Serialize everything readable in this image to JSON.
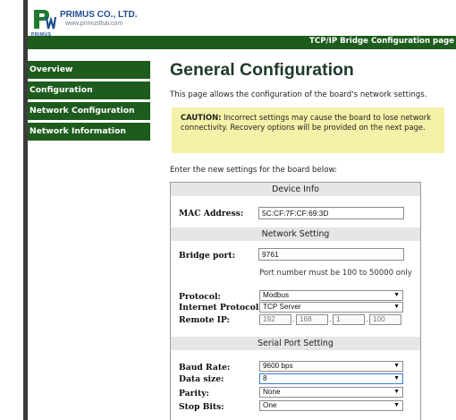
{
  "brand": {
    "company": "PRIMUS CO., LTD.",
    "website": "www.primusthai.com",
    "logo_word": "PRIMUS"
  },
  "header": {
    "title": "TCP/IP Bridge Configuration page"
  },
  "nav": {
    "items": [
      {
        "label": "Overview"
      },
      {
        "label": "Configuration"
      },
      {
        "label": "Network Configuration"
      },
      {
        "label": "Network Information"
      }
    ]
  },
  "main": {
    "title": "General Configuration",
    "intro": "This page allows the configuration of the board's network settings.",
    "caution_label": "CAUTION:",
    "caution_text": " Incorrect settings may cause the board to lose network connectivity. Recovery options will be provided on the next page.",
    "enter_text": "Enter the new settings for the board below:"
  },
  "form": {
    "device_info": {
      "heading": "Device Info",
      "mac_label": "MAC Address:",
      "mac_value": "5C:CF:7F:CF:69:3D"
    },
    "network": {
      "heading": "Network Setting",
      "port_label": "Bridge port:",
      "port_value": "9761",
      "port_hint": "Port number must be 100 to 50000 only",
      "protocol_label": "Protocol:",
      "protocol_value": "Modbus",
      "ip_protocol_label": "Internet Protocol:",
      "ip_protocol_value": "TCP Server",
      "remote_ip_label": "Remote IP:",
      "remote_ip": [
        "192",
        "168",
        "1",
        "100"
      ]
    },
    "serial": {
      "heading": "Serial Port Setting",
      "baud_label": "Baud Rate:",
      "baud_value": "9600 bps",
      "data_size_label": "Data size:",
      "data_size_value": "8",
      "parity_label": "Parity:",
      "parity_value": "None",
      "stop_bits_label": "Stop Bits:",
      "stop_bits_value": "One"
    }
  },
  "colors": {
    "nav_green": "#1e5c1e",
    "caution_bg": "#f5f1a8",
    "section_bg": "#e6e6e6"
  },
  "icons": {
    "dropdown": "triangle-down"
  }
}
